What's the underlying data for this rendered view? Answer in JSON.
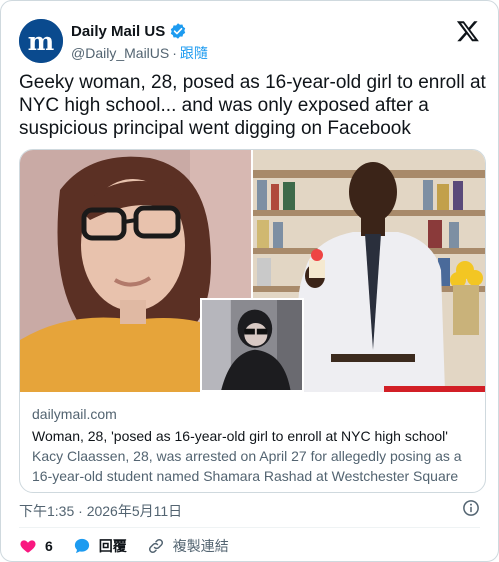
{
  "author": {
    "display_name": "Daily Mail US",
    "handle": "@Daily_MailUS",
    "separator": "·",
    "follow_label": "跟隨"
  },
  "tweet": {
    "text": "Geeky woman, 28, posed as 16-year-old girl to enroll at NYC high school... and was only exposed after a suspicious principal went digging on Facebook"
  },
  "link_card": {
    "domain": "dailymail.com",
    "title": "Woman, 28, 'posed as 16-year-old girl to enroll at NYC high school'",
    "description": "Kacy Claassen, 28, was arrested on April 27 for allegedly posing as a 16-year-old student named Shamara Rashad at Westchester Square ..."
  },
  "timestamp": "下午1:35 · 2026年5月11日",
  "actions": {
    "like_count": "6",
    "reply_label": "回覆",
    "copy_link_label": "複製連結"
  },
  "colors": {
    "accent": "#1d9bf0",
    "like": "#f91880",
    "text_primary": "#0f1419",
    "text_secondary": "#536471",
    "border": "#cfd9de",
    "brand_avatar": "#0a4a8e"
  },
  "icons": [
    "daily-mail-logo-icon",
    "verified-badge-icon",
    "x-logo-icon",
    "info-icon",
    "heart-icon",
    "reply-bubble-icon",
    "link-icon"
  ]
}
